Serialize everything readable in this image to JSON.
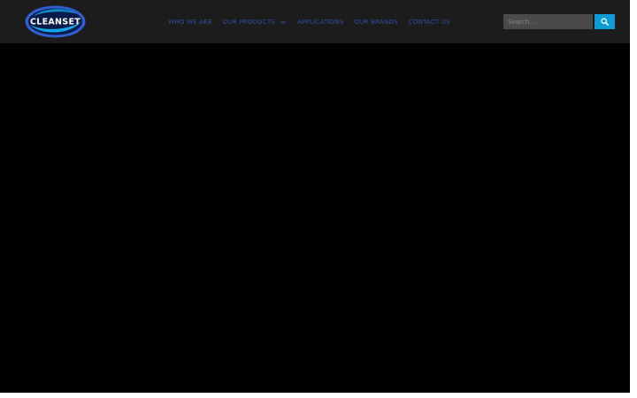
{
  "logo": {
    "text": "CLEANSET",
    "colors": {
      "outer": "#2f5fd0",
      "inner": "#0a1a4a",
      "swoosh": "#12a7e8",
      "text": "#ffffff"
    }
  },
  "nav": {
    "items": [
      {
        "label": "WHO WE ARE"
      },
      {
        "label": "OUR PRODUCTS",
        "has_dropdown": true
      },
      {
        "label": "APPLICATIONS"
      },
      {
        "label": "OUR BRANDS"
      },
      {
        "label": "CONTACT US"
      }
    ]
  },
  "search": {
    "placeholder": "Search...",
    "icon": "search-icon"
  },
  "colors": {
    "header_bg": "#1c1c1c",
    "nav_text": "#2c4fa3",
    "search_button": "#0d9ad6",
    "hero_bg": "#000000"
  }
}
